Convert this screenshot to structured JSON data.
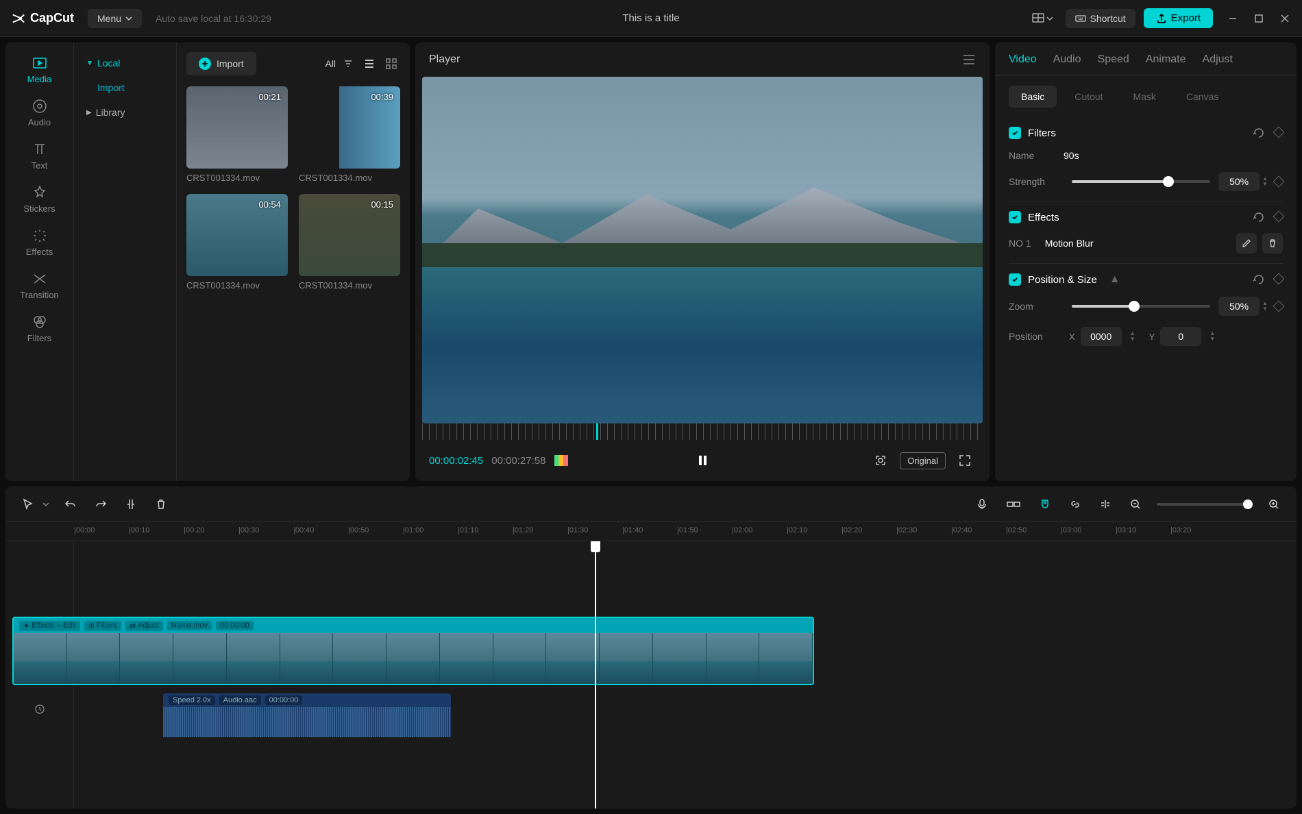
{
  "titlebar": {
    "logo": "CapCut",
    "menu": "Menu",
    "autosave": "Auto save local at 16:30:29",
    "title": "This is a title",
    "shortcut": "Shortcut",
    "export": "Export"
  },
  "tool_tabs": [
    {
      "label": "Media",
      "active": true
    },
    {
      "label": "Audio"
    },
    {
      "label": "Text"
    },
    {
      "label": "Stickers"
    },
    {
      "label": "Effects"
    },
    {
      "label": "Transition"
    },
    {
      "label": "Filters"
    }
  ],
  "media_sidebar": {
    "local": "Local",
    "import": "Import",
    "library": "Library"
  },
  "import_bar": {
    "import": "Import",
    "all": "All"
  },
  "media_items": [
    {
      "duration": "00:21",
      "name": "CRST001334.mov"
    },
    {
      "duration": "00:39",
      "name": "CRST001334.mov"
    },
    {
      "duration": "00:54",
      "name": "CRST001334.mov"
    },
    {
      "duration": "00:15",
      "name": "CRST001334.mov"
    }
  ],
  "player": {
    "title": "Player",
    "current": "00:00:02:45",
    "total": "00:00:27:58",
    "original": "Original"
  },
  "prop_tabs": [
    "Video",
    "Audio",
    "Speed",
    "Animate",
    "Adjust"
  ],
  "sub_tabs": [
    "Basic",
    "Cutout",
    "Mask",
    "Canvas"
  ],
  "filters": {
    "title": "Filters",
    "name_label": "Name",
    "name_value": "90s",
    "strength_label": "Strength",
    "strength_value": "50%",
    "strength_pct": 70
  },
  "effects": {
    "title": "Effects",
    "num": "NO 1",
    "name": "Motion Blur"
  },
  "position": {
    "title": "Position & Size",
    "zoom_label": "Zoom",
    "zoom_value": "50%",
    "zoom_pct": 45,
    "pos_label": "Position",
    "x_label": "X",
    "x_value": "0000",
    "y_label": "Y",
    "y_value": "0"
  },
  "timeline": {
    "ticks": [
      "00:00",
      "00:10",
      "00:20",
      "00:30",
      "00:40",
      "00:50",
      "01:00",
      "01:10",
      "01:20",
      "01:30",
      "01:40",
      "01:50",
      "02:00",
      "02:10",
      "02:20",
      "02:30",
      "02:40",
      "02:50",
      "03:00",
      "03:10",
      "03:20"
    ],
    "video_clip": {
      "tag_effects": "Effects – Edit",
      "tag_filters": "Filters",
      "tag_adjust": "Adjust",
      "name": "Name.mov",
      "time": "00:00:00"
    },
    "audio_clip": {
      "speed": "Speed 2.0x",
      "name": "Audio.aac",
      "time": "00:00:00"
    }
  }
}
